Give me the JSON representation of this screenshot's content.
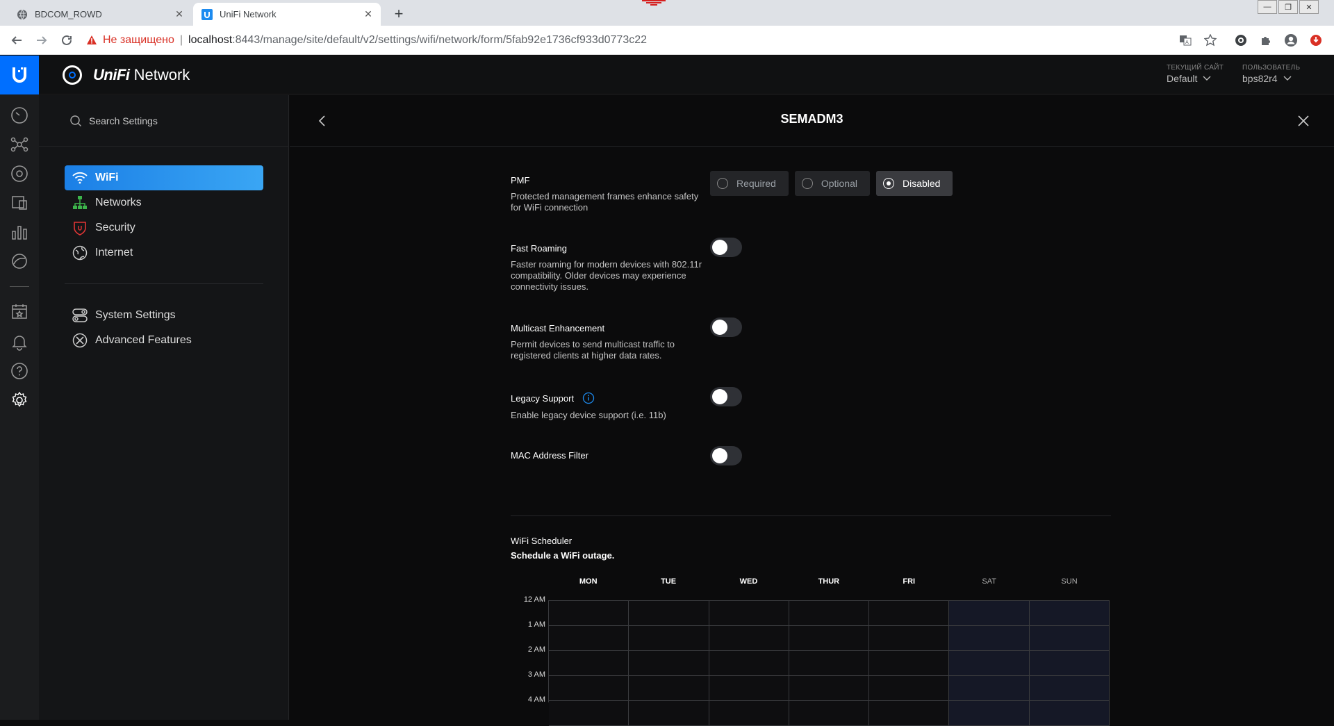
{
  "browser": {
    "tabs": [
      {
        "title": "BDCOM_ROWD",
        "active": false
      },
      {
        "title": "UniFi Network",
        "active": true
      }
    ],
    "not_secure_label": "Не защищено",
    "url_host": "localhost",
    "url_rest": ":8443/manage/site/default/v2/settings/wifi/network/form/5fab92e1736cf933d0773c22"
  },
  "app": {
    "brand_bold": "UniFi",
    "brand_rest": " Network",
    "site": {
      "label": "ТЕКУЩИЙ САЙТ",
      "value": "Default"
    },
    "user": {
      "label": "ПОЛЬЗОВАТЕЛЬ",
      "value": "bps82r4"
    }
  },
  "sidebar": {
    "search_placeholder": "Search Settings",
    "items": [
      {
        "label": "WiFi",
        "icon": "wifi-icon",
        "active": true
      },
      {
        "label": "Networks",
        "icon": "network-tree-icon"
      },
      {
        "label": "Security",
        "icon": "shield-icon"
      },
      {
        "label": "Internet",
        "icon": "globe-icon"
      }
    ],
    "items2": [
      {
        "label": "System Settings",
        "icon": "toggles-icon"
      },
      {
        "label": "Advanced Features",
        "icon": "tools-icon"
      }
    ]
  },
  "main": {
    "title": "SEMADM3",
    "pmf": {
      "title": "PMF",
      "desc": "Protected management frames enhance safety for WiFi connection",
      "options": [
        "Required",
        "Optional",
        "Disabled"
      ],
      "selected": "Disabled"
    },
    "fast_roaming": {
      "title": "Fast Roaming",
      "desc": "Faster roaming for modern devices with 802.11r compatibility. Older devices may experience connectivity issues.",
      "enabled": false
    },
    "multicast": {
      "title": "Multicast Enhancement",
      "desc": "Permit devices to send multicast traffic to registered clients at higher data rates.",
      "enabled": false
    },
    "legacy": {
      "title": "Legacy Support",
      "desc": "Enable legacy device support (i.e. 11b)",
      "enabled": false
    },
    "mac_filter": {
      "title": "MAC Address Filter",
      "enabled": false
    },
    "scheduler": {
      "title": "WiFi Scheduler",
      "subtitle": "Schedule a WiFi outage.",
      "days": [
        "MON",
        "TUE",
        "WED",
        "THUR",
        "FRI",
        "SAT",
        "SUN"
      ],
      "hours": [
        "12 AM",
        "1 AM",
        "2 AM",
        "3 AM",
        "4 AM"
      ]
    }
  }
}
